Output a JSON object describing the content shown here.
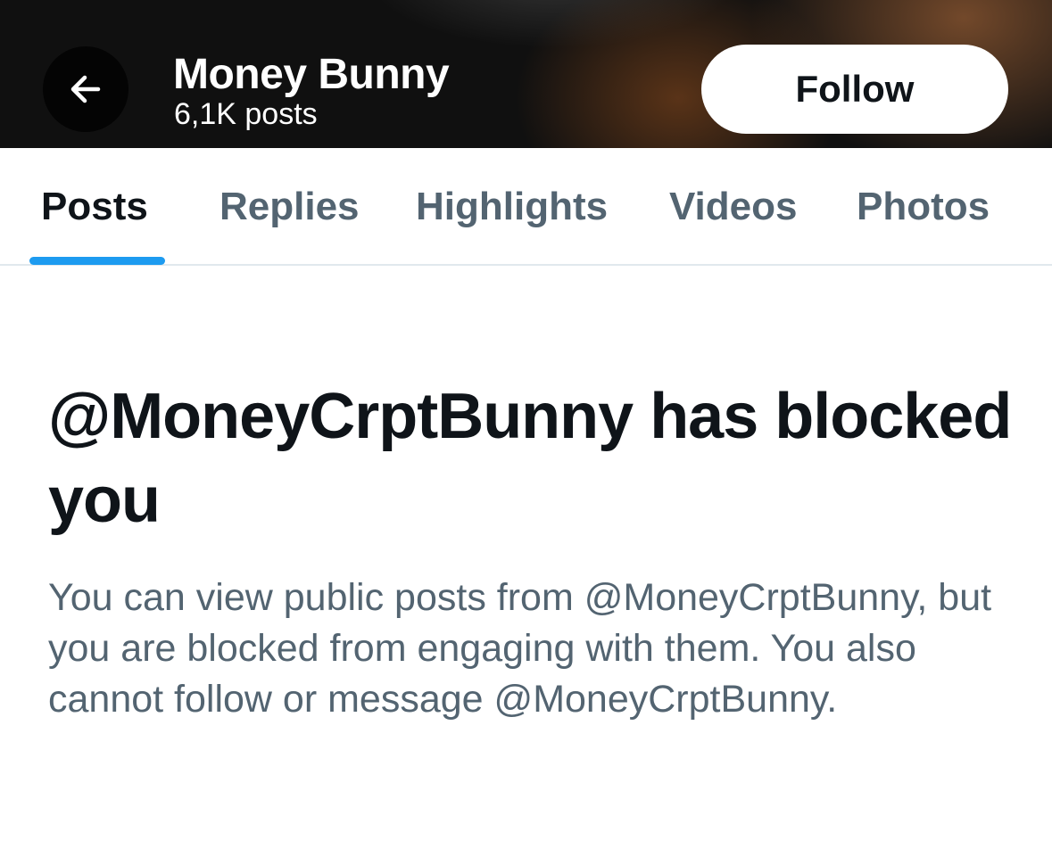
{
  "header": {
    "back_icon": "arrow-left-icon",
    "title": "Money Bunny",
    "post_count": "6,1K posts",
    "follow_label": "Follow"
  },
  "tabs": [
    {
      "label": "Posts",
      "active": true
    },
    {
      "label": "Replies",
      "active": false
    },
    {
      "label": "Highlights",
      "active": false
    },
    {
      "label": "Videos",
      "active": false
    },
    {
      "label": "Photos",
      "active": false
    }
  ],
  "blocked": {
    "title": "@MoneyCrptBunny has blocked you",
    "description": "You can view public posts from @MoneyCrptBunny, but you are blocked from engaging with them. You also cannot follow or message @MoneyCrptBunny."
  },
  "colors": {
    "accent": "#1d9bf0",
    "primary_text": "#0f1419",
    "secondary_text": "#536471",
    "divider": "#e1e8ed"
  }
}
